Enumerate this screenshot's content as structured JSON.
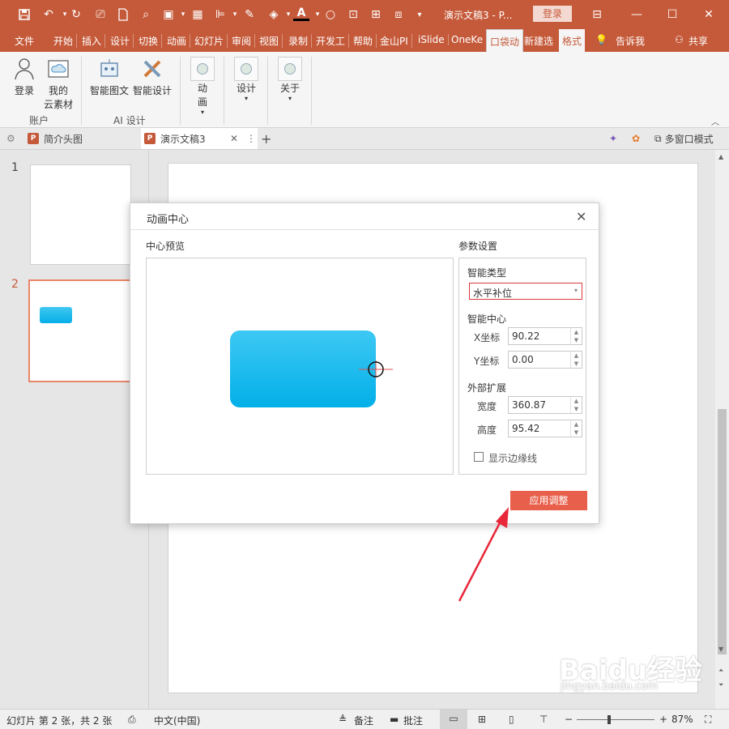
{
  "window": {
    "title": "演示文稿3 - P...",
    "login_label": "登录",
    "minimize": "—",
    "maximize": "☐",
    "close": "✕"
  },
  "menu_tabs": [
    "文件",
    "开始",
    "插入",
    "设计",
    "切换",
    "动画",
    "幻灯片",
    "审阅",
    "视图",
    "录制",
    "开发工",
    "帮助",
    "金山PI",
    "iSlide",
    "OneKe",
    "口袋动",
    "新建选",
    "格式",
    "告诉我",
    "共享"
  ],
  "ribbon": {
    "account_group": {
      "login": "登录",
      "cloud_line1": "我的",
      "cloud_line2": "云素材",
      "label": "账户"
    },
    "ai_group": {
      "smart_graphic": "智能图文",
      "smart_design": "智能设计",
      "label": "AI 设计"
    },
    "anim": {
      "line1": "动",
      "line2": "画"
    },
    "design": "设计",
    "about": "关于"
  },
  "doc_tabs": [
    {
      "label": "简介头图"
    },
    {
      "label": "演示文稿3"
    }
  ],
  "doc_tab_right": {
    "multi_window": "多窗口模式"
  },
  "slides": [
    {
      "number": "1"
    },
    {
      "number": "2"
    }
  ],
  "dialog": {
    "title": "动画中心",
    "preview_label": "中心预览",
    "params_label": "参数设置",
    "smart_type_label": "智能类型",
    "smart_type_value": "水平补位",
    "smart_center_label": "智能中心",
    "x_label": "X坐标",
    "x_value": "90.22",
    "y_label": "Y坐标",
    "y_value": "0.00",
    "extend_label": "外部扩展",
    "width_label": "宽度",
    "width_value": "360.87",
    "height_label": "高度",
    "height_value": "95.42",
    "show_edges_label": "显示边缘线",
    "apply_label": "应用调整"
  },
  "statusbar": {
    "slide_info": "幻灯片 第 2 张，共 2 张",
    "language": "中文(中国)",
    "notes": "备注",
    "comments": "批注",
    "zoom": "87%"
  },
  "watermark": {
    "brand": "Baidu经验",
    "url": "jingyan.baidu.com"
  },
  "colors": {
    "accent": "#c55a3a",
    "shape": "#1ab7ea",
    "apply": "#e8604c",
    "arrow": "#e8283a"
  }
}
